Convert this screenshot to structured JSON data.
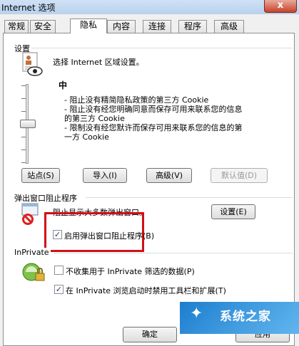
{
  "window": {
    "title": "Internet 选项",
    "close_label": "x"
  },
  "tabs": [
    {
      "label": "常规"
    },
    {
      "label": "安全"
    },
    {
      "label": "隐私"
    },
    {
      "label": "内容"
    },
    {
      "label": "连接"
    },
    {
      "label": "程序"
    },
    {
      "label": "高级"
    }
  ],
  "active_tab": "隐私",
  "settings": {
    "group_label": "设置",
    "prompt": "选择 Internet 区域设置。",
    "level": "中",
    "slider_level": "中",
    "desc_1": "- 阻止没有精简隐私政策的第三方 Cookie",
    "desc_2": "- 阻止没有经您明确同意而保存可用来联系您的信息",
    "desc_2b": "的第三方 Cookie",
    "desc_3": "- 限制没有经您默许而保存可用来联系您的信息的第",
    "desc_3b": "一方 Cookie",
    "buttons": {
      "sites": "站点(S)",
      "import": "导入(I)",
      "advanced": "高级(V)",
      "default": "默认值(D)"
    }
  },
  "popup": {
    "group_label": "弹出窗口阻止程序",
    "desc": "阻止显示大多数弹出窗口。",
    "settings_button": "设置(E)",
    "enable_label": "启用弹出窗口阻止程序(B)",
    "enable_checked": true
  },
  "inprivate": {
    "group_label": "InPrivate",
    "opt1_label": "不收集用于 InPrivate 筛选的数据(P)",
    "opt1_checked": false,
    "opt2_label": "在 InPrivate 浏览启动时禁用工具栏和扩展(T)",
    "opt2_checked": true
  },
  "dialog_buttons": {
    "ok": "确定",
    "apply": "应用"
  },
  "watermark": {
    "text": "系统之家"
  }
}
